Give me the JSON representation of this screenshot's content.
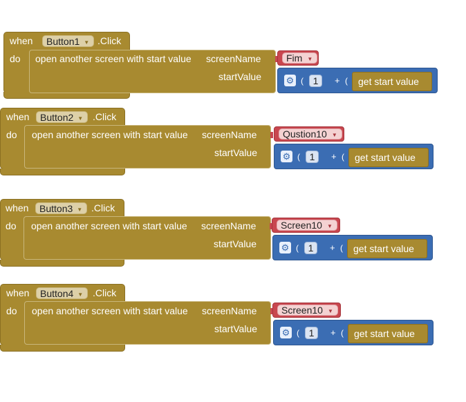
{
  "events": [
    {
      "when_label": "when",
      "button": "Button1",
      "event": ".Click",
      "do_label": "do",
      "action": "open another screen with start value",
      "screen_name_label": "screenName",
      "start_value_label": "startValue",
      "screen_value": "Fim",
      "number": "1",
      "plus": "+",
      "get_start_value": "get start value"
    },
    {
      "when_label": "when",
      "button": "Button2",
      "event": ".Click",
      "do_label": "do",
      "action": "open another screen with start value",
      "screen_name_label": "screenName",
      "start_value_label": "startValue",
      "screen_value": "Qustion10",
      "number": "1",
      "plus": "+",
      "get_start_value": "get start value"
    },
    {
      "when_label": "when",
      "button": "Button3",
      "event": ".Click",
      "do_label": "do",
      "action": "open another screen with start value",
      "screen_name_label": "screenName",
      "start_value_label": "startValue",
      "screen_value": "Screen10",
      "number": "1",
      "plus": "+",
      "get_start_value": "get start value"
    },
    {
      "when_label": "when",
      "button": "Button4",
      "event": ".Click",
      "do_label": "do",
      "action": "open another screen with start value",
      "screen_name_label": "screenName",
      "start_value_label": "startValue",
      "screen_value": "Screen10",
      "number": "1",
      "plus": "+",
      "get_start_value": "get start value"
    }
  ],
  "icons": {
    "dropdown": "triangle-down",
    "mutator": "gear"
  },
  "colors": {
    "event_block": "#a88a30",
    "text_block": "#c8474f",
    "math_block": "#3b6db3"
  }
}
